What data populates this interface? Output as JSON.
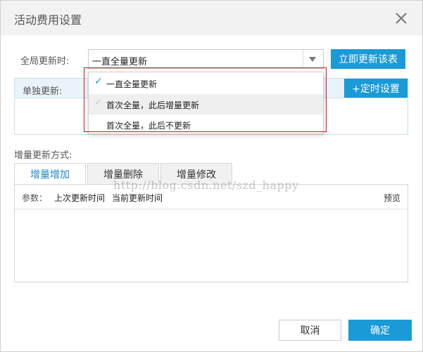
{
  "dialog": {
    "title": "活动费用设置",
    "close_icon": "close-icon"
  },
  "global_update": {
    "label": "全局更新时:",
    "selected": "一直全量更新",
    "arrow_icon": "triangle-down-icon",
    "update_button": "立即更新该表"
  },
  "dropdown": {
    "options": [
      {
        "label": "一直全量更新",
        "checked": true
      },
      {
        "label": "首次全量，此后增量更新",
        "checked": false,
        "hover": true
      },
      {
        "label": "首次全量，此后不更新",
        "checked": false
      }
    ],
    "check_icon": "checkmark-icon"
  },
  "single_update": {
    "label": "单独更新:",
    "timer_button": "+定时设置"
  },
  "incremental": {
    "label": "增量更新方式:",
    "tabs": [
      {
        "label": "增量增加",
        "active": true
      },
      {
        "label": "增量删除",
        "active": false
      },
      {
        "label": "增量修改",
        "active": false
      }
    ],
    "params_label": "参数：",
    "params": [
      "上次更新时间",
      "当前更新时间"
    ],
    "preview": "预览"
  },
  "watermark": "http://blog.csdn.net/szd_happy",
  "footer": {
    "cancel": "取消",
    "ok": "确定"
  },
  "colors": {
    "accent": "#1a9ad6",
    "header_bg": "#f2f2f2",
    "highlight_border": "#d01515"
  }
}
